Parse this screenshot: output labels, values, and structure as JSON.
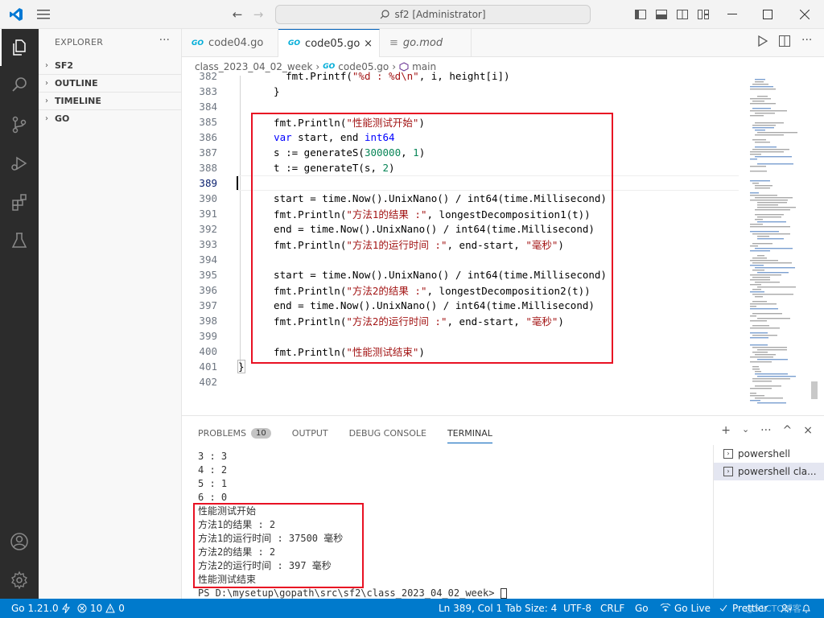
{
  "window": {
    "title": "sf2 [Administrator]",
    "nav_back": "←",
    "nav_forward": "→"
  },
  "sidebar": {
    "header": "EXPLORER",
    "more": "···",
    "sections": [
      {
        "label": "SF2"
      },
      {
        "label": "OUTLINE"
      },
      {
        "label": "TIMELINE"
      },
      {
        "label": "GO"
      }
    ]
  },
  "tabs": [
    {
      "label": "code04.go",
      "badge": "GO",
      "active": false
    },
    {
      "label": "code05.go",
      "badge": "GO",
      "active": true,
      "close": "×"
    },
    {
      "label": "go.mod",
      "badge": "≡",
      "active": false
    }
  ],
  "breadcrumb": {
    "folder": "class_2023_04_02_week",
    "file": "code05.go",
    "symbol": "main",
    "sep": "›"
  },
  "code": {
    "lines": [
      {
        "n": "382",
        "text": "    fmt.Printf(\"%d : %d\\n\", i, height[i])"
      },
      {
        "n": "383",
        "text": "  }"
      },
      {
        "n": "384",
        "text": ""
      },
      {
        "n": "385",
        "text": "  fmt.Println(\"性能测试开始\")"
      },
      {
        "n": "386",
        "text": "  var start, end int64"
      },
      {
        "n": "387",
        "text": "  s := generateS(300000, 1)"
      },
      {
        "n": "388",
        "text": "  t := generateT(s, 2)"
      },
      {
        "n": "389",
        "text": ""
      },
      {
        "n": "390",
        "text": "  start = time.Now().UnixNano() / int64(time.Millisecond)"
      },
      {
        "n": "391",
        "text": "  fmt.Println(\"方法1的结果 :\", longestDecomposition1(t))"
      },
      {
        "n": "392",
        "text": "  end = time.Now().UnixNano() / int64(time.Millisecond)"
      },
      {
        "n": "393",
        "text": "  fmt.Println(\"方法1的运行时间 :\", end-start, \"毫秒\")"
      },
      {
        "n": "394",
        "text": ""
      },
      {
        "n": "395",
        "text": "  start = time.Now().UnixNano() / int64(time.Millisecond)"
      },
      {
        "n": "396",
        "text": "  fmt.Println(\"方法2的结果 :\", longestDecomposition2(t))"
      },
      {
        "n": "397",
        "text": "  end = time.Now().UnixNano() / int64(time.Millisecond)"
      },
      {
        "n": "398",
        "text": "  fmt.Println(\"方法2的运行时间 :\", end-start, \"毫秒\")"
      },
      {
        "n": "399",
        "text": ""
      },
      {
        "n": "400",
        "text": "  fmt.Println(\"性能测试结束\")"
      },
      {
        "n": "401",
        "text": "}"
      },
      {
        "n": "402",
        "text": ""
      }
    ]
  },
  "panel": {
    "tabs": [
      {
        "label": "PROBLEMS",
        "badge": "10"
      },
      {
        "label": "OUTPUT"
      },
      {
        "label": "DEBUG CONSOLE"
      },
      {
        "label": "TERMINAL",
        "active": true
      }
    ],
    "add": "+",
    "add_chevron": "⌄",
    "more": "···",
    "maximize": "^",
    "close": "×"
  },
  "terminal": {
    "lines": [
      "3 : 3",
      "4 : 2",
      "5 : 1",
      "6 : 0",
      "性能测试开始",
      "方法1的结果 : 2",
      "方法1的运行时间 : 37500 毫秒",
      "方法2的结果 : 2",
      "方法2的运行时间 : 397 毫秒",
      "性能测试结束",
      "PS D:\\mysetup\\gopath\\src\\sf2\\class_2023_04_02_week> "
    ],
    "list": [
      {
        "label": "powershell",
        "selected": false
      },
      {
        "label": "powershell  cla...",
        "selected": true
      }
    ]
  },
  "status": {
    "go_version": "Go 1.21.0",
    "errors": "10",
    "warnings": "0",
    "position": "Ln 389, Col 1",
    "tab_size": "Tab Size: 4",
    "encoding": "UTF-8",
    "eol": "CRLF",
    "language": "Go",
    "go_live": "Go Live",
    "prettier": "Prettier",
    "watermark": "@51CTO博客"
  },
  "colors": {
    "accent": "#007acc",
    "highlight_box": "#e81123",
    "activity_bar": "#2c2c2c"
  }
}
